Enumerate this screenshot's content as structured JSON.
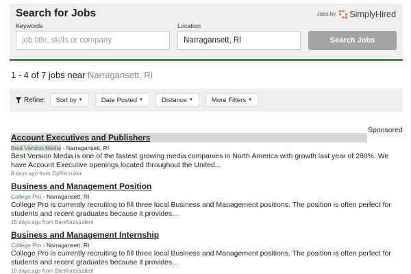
{
  "search": {
    "title": "Search for Jobs",
    "jobs_by_label": "Jobs by",
    "brand": "SimplyHired",
    "keywords_label": "Keywords",
    "keywords_placeholder": "job title, skills or company",
    "keywords_value": "",
    "location_label": "Location",
    "location_value": "Narragansett, RI",
    "search_button": "Search Jobs"
  },
  "results": {
    "summary_prefix": "1 - 4 of 7  jobs near ",
    "summary_location": "Narragansett, RI"
  },
  "refine": {
    "label": "Refine:",
    "filters": [
      "Sort by",
      "Date Posted",
      "Distance",
      "More Filters"
    ]
  },
  "sponsored_label": "Sponsored",
  "jobs": [
    {
      "title": "Account Executives and Publishers",
      "company": "Best Version Media",
      "location": " - Narragansett, RI",
      "description": "Best Version Media is one of the fastest growing media companies in North America with growth last year of 280%. We have Account Executive openings located throughout the United...",
      "age": "8 days ago from ZipRecruiter"
    },
    {
      "title": "Business and Management Position",
      "company": "College Pro",
      "location": " - Narragansett, RI",
      "description": "College Pro is currently recruiting to fill three local Business and Management positions. The position is often perfect for students and recent graduates because it provides...",
      "age": "15 days ago from Barefootstudent"
    },
    {
      "title": "Business and Management Internship",
      "company": "College Pro",
      "location": " - Narragansett, RI",
      "description": "College Pro is currently recruiting to fill three local Business and Management positions. The position is often perfect for students and recent graduates because it provides...",
      "age": "19 days ago from Barefootstudent"
    }
  ],
  "colors": {
    "accent_green": "#3c8a3c",
    "panel_gray": "#efefef",
    "button_gray": "#a3a3a3"
  },
  "icons": {
    "brand_logo": "simplyhired-logo-icon",
    "refine": "funnel-icon",
    "dropdown": "caret-down-icon"
  }
}
